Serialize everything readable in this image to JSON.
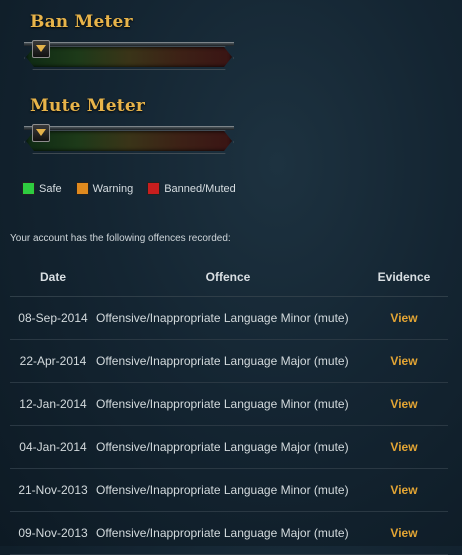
{
  "ban_meter": {
    "title": "Ban Meter",
    "level": 0
  },
  "mute_meter": {
    "title": "Mute Meter",
    "level": 0
  },
  "legend": [
    {
      "label": "Safe",
      "color": "#2ecc40"
    },
    {
      "label": "Warning",
      "color": "#e08a1e"
    },
    {
      "label": "Banned/Muted",
      "color": "#c81e1e"
    }
  ],
  "intro_text": "Your account has the following offences recorded:",
  "table": {
    "headers": {
      "date": "Date",
      "offence": "Offence",
      "evidence": "Evidence"
    },
    "rows": [
      {
        "date": "08-Sep-2014",
        "offence": "Offensive/Inappropriate Language Minor (mute)",
        "evidence": "View"
      },
      {
        "date": "22-Apr-2014",
        "offence": "Offensive/Inappropriate Language Major (mute)",
        "evidence": "View"
      },
      {
        "date": "12-Jan-2014",
        "offence": "Offensive/Inappropriate Language Minor (mute)",
        "evidence": "View"
      },
      {
        "date": "04-Jan-2014",
        "offence": "Offensive/Inappropriate Language Major (mute)",
        "evidence": "View"
      },
      {
        "date": "21-Nov-2013",
        "offence": "Offensive/Inappropriate Language Minor (mute)",
        "evidence": "View"
      },
      {
        "date": "09-Nov-2013",
        "offence": "Offensive/Inappropriate Language Major (mute)",
        "evidence": "View"
      }
    ]
  }
}
